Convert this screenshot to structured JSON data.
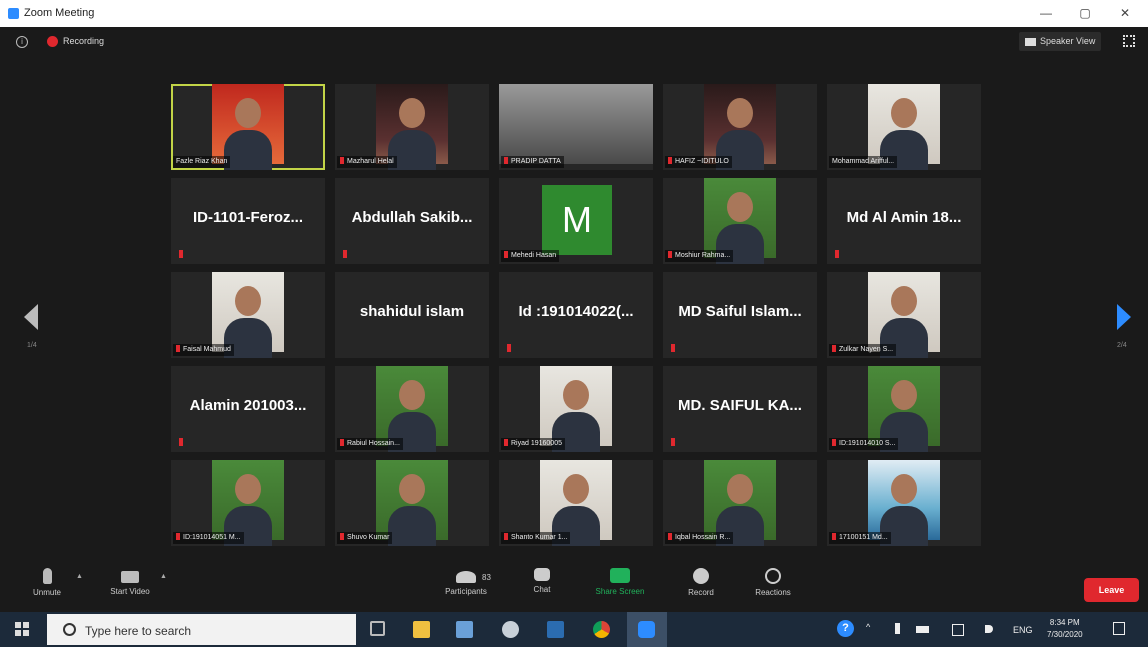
{
  "window": {
    "title": "Zoom Meeting",
    "controls": {
      "minimize": "—",
      "restore": "▢",
      "close": "✕"
    }
  },
  "meeting_bar": {
    "info_icon": "info-icon",
    "recording_label": "Recording",
    "speaker_view_label": "Speaker View",
    "fullscreen_icon": "fullscreen-icon"
  },
  "paging": {
    "left_page": "1/4",
    "right_page": "2/4"
  },
  "participants": [
    {
      "kind": "video",
      "name": "Fazle Riaz Khan",
      "active": true,
      "muted": false,
      "style": "v-red"
    },
    {
      "kind": "video",
      "name": "Mazharul Helal",
      "muted": true,
      "style": "v-dark"
    },
    {
      "kind": "video",
      "name": "PRADIP DATTA",
      "muted": true,
      "style": "v-wide"
    },
    {
      "kind": "video",
      "name": "HAFIZ ~IDITULO",
      "muted": true,
      "style": "v-dark"
    },
    {
      "kind": "video",
      "name": "Mohammad Arifful...",
      "muted": false,
      "style": "v-light"
    },
    {
      "kind": "name",
      "name": "ID-1101-Feroz...",
      "muted": true
    },
    {
      "kind": "name",
      "name": "Abdullah Sakib...",
      "muted": true
    },
    {
      "kind": "avatar",
      "letter": "M",
      "name": "Mehedi Hasan",
      "muted": true
    },
    {
      "kind": "video",
      "name": "Moshiur Rahma...",
      "muted": true,
      "style": "v-green"
    },
    {
      "kind": "name",
      "name": "Md Al Amin 18...",
      "muted": true
    },
    {
      "kind": "video",
      "name": "Faisal Mahmud",
      "muted": true,
      "style": "v-light"
    },
    {
      "kind": "name",
      "name": "shahidul islam",
      "muted": false
    },
    {
      "kind": "name",
      "name": "Id :191014022(...",
      "muted": true
    },
    {
      "kind": "name",
      "name": "MD Saiful Islam...",
      "muted": true
    },
    {
      "kind": "video",
      "name": "Zulkar Nayen S...",
      "muted": true,
      "style": "v-light"
    },
    {
      "kind": "name",
      "name": "Alamin 201003...",
      "muted": true
    },
    {
      "kind": "video",
      "name": "Rabiul Hossain...",
      "muted": true,
      "style": "v-green"
    },
    {
      "kind": "video",
      "name": "Riyad 19160005",
      "muted": true,
      "style": "v-light"
    },
    {
      "kind": "name",
      "name": "MD. SAIFUL KA...",
      "muted": true
    },
    {
      "kind": "video",
      "name": "ID:191014010 S...",
      "muted": true,
      "style": "v-green"
    },
    {
      "kind": "video",
      "name": "ID:191014051 M...",
      "muted": true,
      "style": "v-green"
    },
    {
      "kind": "video",
      "name": "Shuvo Kumar",
      "muted": true,
      "style": "v-green"
    },
    {
      "kind": "video",
      "name": "Shanto Kumar 1...",
      "muted": true,
      "style": "v-light"
    },
    {
      "kind": "video",
      "name": "Iqbal Hossain R...",
      "muted": true,
      "style": "v-green"
    },
    {
      "kind": "video",
      "name": "17100151 Md...",
      "muted": true,
      "style": "v-pool"
    }
  ],
  "toolbar": {
    "unmute_label": "Unmute",
    "start_video_label": "Start Video",
    "participants_label": "Participants",
    "participants_count": "83",
    "chat_label": "Chat",
    "share_screen_label": "Share Screen",
    "record_label": "Record",
    "reactions_label": "Reactions",
    "leave_label": "Leave",
    "share_color": "#21b15b",
    "leave_color": "#e0282e"
  },
  "taskbar": {
    "search_placeholder": "Type here to search",
    "language": "ENG",
    "time": "8:34 PM",
    "date": "7/30/2020"
  }
}
